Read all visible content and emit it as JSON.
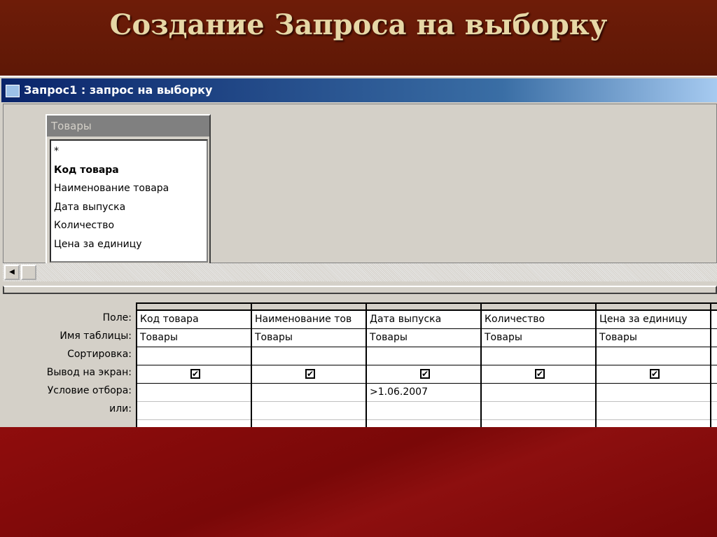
{
  "slide_title": "Создание Запроса на выборку",
  "window": {
    "title": "Запрос1 : запрос на выборку"
  },
  "table": {
    "name": "Товары",
    "fields": [
      "*",
      "Код товара",
      "Наименование товара",
      "Дата выпуска",
      "Количество",
      "Цена за единицу"
    ],
    "bold_field": "Код товара"
  },
  "grid": {
    "row_labels": [
      "Поле:",
      "Имя таблицы:",
      "Сортировка:",
      "Вывод на экран:",
      "Условие отбора:",
      "или:"
    ],
    "columns": [
      {
        "field": "Код товара",
        "table": "Товары",
        "sort": "",
        "show": true,
        "criteria": "",
        "or": ""
      },
      {
        "field": "Наименование тов",
        "table": "Товары",
        "sort": "",
        "show": true,
        "criteria": "",
        "or": ""
      },
      {
        "field": "Дата выпуска",
        "table": "Товары",
        "sort": "",
        "show": true,
        "criteria": ">1.06.2007",
        "or": ""
      },
      {
        "field": "Количество",
        "table": "Товары",
        "sort": "",
        "show": true,
        "criteria": "",
        "or": ""
      },
      {
        "field": "Цена за единицу",
        "table": "Товары",
        "sort": "",
        "show": true,
        "criteria": "",
        "or": ""
      }
    ]
  },
  "checkmark": "✔"
}
